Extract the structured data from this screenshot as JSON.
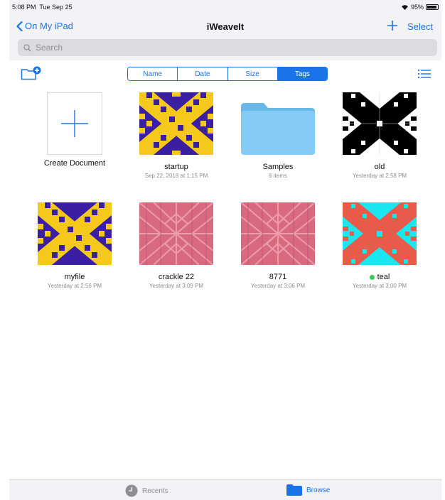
{
  "status": {
    "time": "5:08 PM",
    "date": "Tue Sep 25",
    "battery": "95%"
  },
  "nav": {
    "back_label": "On My iPad",
    "title": "iWeaveIt",
    "select_label": "Select"
  },
  "search": {
    "placeholder": "Search"
  },
  "sort": {
    "options": [
      "Name",
      "Date",
      "Size",
      "Tags"
    ],
    "active": "Tags"
  },
  "create": {
    "label": "Create Document"
  },
  "items": [
    {
      "name": "startup",
      "sub": "Sep 22, 2018 at 1:15 PM",
      "thumb": "pattern-purple-yellow"
    },
    {
      "name": "Samples",
      "sub": "6 items",
      "thumb": "folder-icon"
    },
    {
      "name": "old",
      "sub": "Yesterday at 2:58 PM",
      "thumb": "pattern-black-white"
    },
    {
      "name": "myfile",
      "sub": "Yesterday at 2:56 PM",
      "thumb": "pattern-purple-yellow"
    },
    {
      "name": "crackle 22",
      "sub": "Yesterday at 3:09 PM",
      "thumb": "pattern-pink"
    },
    {
      "name": "8771",
      "sub": "Yesterday at 3:06 PM",
      "thumb": "pattern-pink"
    },
    {
      "name": "teal",
      "sub": "Yesterday at 3:00 PM",
      "thumb": "pattern-cyan-red",
      "tag_color": "#3bc75b"
    }
  ],
  "tabs": {
    "recents": "Recents",
    "browse": "Browse"
  },
  "colors": {
    "accent": "#1a73e8",
    "purple": "#3a1fa3",
    "yellow": "#f4c91b",
    "pink": "#d86a80",
    "cyan": "#19e6ef",
    "red": "#e85a4a",
    "folder": "#7cc6f2"
  }
}
